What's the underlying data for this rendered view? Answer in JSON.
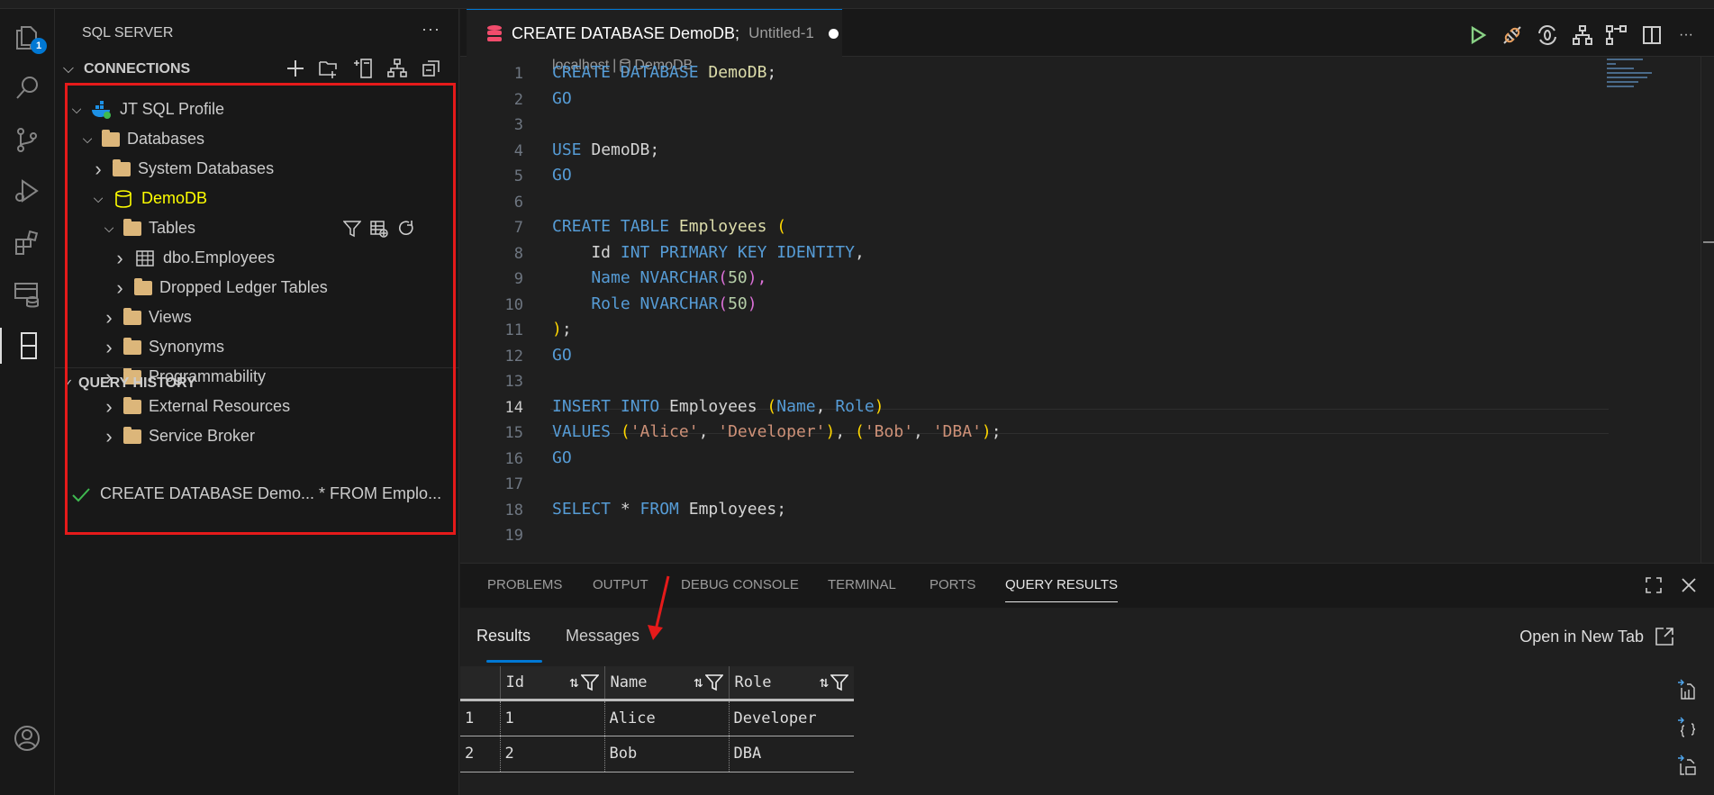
{
  "activity_bar": {
    "explorer_badge": "1"
  },
  "sidebar": {
    "title": "SQL SERVER",
    "more": "···",
    "connections_label": "CONNECTIONS",
    "tree": [
      {
        "label": "JT SQL Profile",
        "depth": 0,
        "twisty": "open",
        "icon": "docker-server-icon"
      },
      {
        "label": "Databases",
        "depth": 1,
        "twisty": "open",
        "icon": "folder-icon"
      },
      {
        "label": "System Databases",
        "depth": 2,
        "twisty": "closed",
        "icon": "folder-icon"
      },
      {
        "label": "DemoDB",
        "depth": 2,
        "twisty": "open",
        "icon": "database-icon",
        "highlight": "#ffff00"
      },
      {
        "label": "Tables",
        "depth": 3,
        "twisty": "open",
        "icon": "folder-icon"
      },
      {
        "label": "dbo.Employees",
        "depth": 4,
        "twisty": "closed",
        "icon": "table-icon"
      },
      {
        "label": "Dropped Ledger Tables",
        "depth": 4,
        "twisty": "closed",
        "icon": "folder-icon"
      },
      {
        "label": "Views",
        "depth": 3,
        "twisty": "closed",
        "icon": "folder-icon"
      },
      {
        "label": "Synonyms",
        "depth": 3,
        "twisty": "closed",
        "icon": "folder-icon"
      },
      {
        "label": "Programmability",
        "depth": 3,
        "twisty": "closed",
        "icon": "folder-icon"
      },
      {
        "label": "External Resources",
        "depth": 3,
        "twisty": "closed",
        "icon": "folder-icon"
      },
      {
        "label": "Service Broker",
        "depth": 3,
        "twisty": "closed",
        "icon": "folder-icon"
      }
    ],
    "query_history_label": "QUERY HISTORY",
    "query_history": [
      {
        "text": "CREATE DATABASE Demo... * FROM Emplo...",
        "status": "success"
      }
    ]
  },
  "editor": {
    "tab_title": "CREATE DATABASE DemoDB;",
    "tab_subtitle": "Untitled-1",
    "breadcrumb_server": "localhost",
    "breadcrumb_sep": "|",
    "breadcrumb_db": "DemoDB",
    "current_line": 14,
    "lines": [
      [
        [
          "CREATE DATABASE ",
          "kw"
        ],
        [
          "DemoDB",
          "id"
        ],
        [
          ";",
          "pl"
        ]
      ],
      [
        [
          "GO",
          "kw"
        ]
      ],
      [],
      [
        [
          "USE ",
          "kw"
        ],
        [
          "DemoDB;",
          "pl"
        ]
      ],
      [
        [
          "GO",
          "kw"
        ]
      ],
      [],
      [
        [
          "CREATE TABLE ",
          "kw"
        ],
        [
          "Employees ",
          "id"
        ],
        [
          "(",
          "br"
        ]
      ],
      [
        [
          "    Id ",
          "pl"
        ],
        [
          "INT PRIMARY KEY IDENTITY",
          "kw"
        ],
        [
          ",",
          "pl"
        ]
      ],
      [
        [
          "    Name ",
          "kw"
        ],
        [
          "NVARCHAR",
          "kw"
        ],
        [
          "(",
          "bn"
        ],
        [
          "50",
          "nm"
        ],
        [
          "),",
          "bn"
        ]
      ],
      [
        [
          "    Role ",
          "kw"
        ],
        [
          "NVARCHAR",
          "kw"
        ],
        [
          "(",
          "bn"
        ],
        [
          "50",
          "nm"
        ],
        [
          ")",
          "bn"
        ]
      ],
      [
        [
          ")",
          "br"
        ],
        [
          ";",
          "pl"
        ]
      ],
      [
        [
          "GO",
          "kw"
        ]
      ],
      [],
      [
        [
          "INSERT INTO ",
          "kw"
        ],
        [
          "Employees ",
          "pl"
        ],
        [
          "(",
          "br"
        ],
        [
          "Name",
          "kw"
        ],
        [
          ", ",
          "pl"
        ],
        [
          "Role",
          "kw"
        ],
        [
          ")",
          "br"
        ]
      ],
      [
        [
          "VALUES ",
          "kw"
        ],
        [
          "(",
          "br"
        ],
        [
          "'Alice'",
          "str"
        ],
        [
          ", ",
          "pl"
        ],
        [
          "'Developer'",
          "str"
        ],
        [
          ")",
          "br"
        ],
        [
          ", ",
          "pl"
        ],
        [
          "(",
          "br"
        ],
        [
          "'Bob'",
          "str"
        ],
        [
          ", ",
          "pl"
        ],
        [
          "'DBA'",
          "str"
        ],
        [
          ")",
          "br"
        ],
        [
          ";",
          "pl"
        ]
      ],
      [
        [
          "GO",
          "kw"
        ]
      ],
      [],
      [
        [
          "SELECT ",
          "kw"
        ],
        [
          "* ",
          "pl"
        ],
        [
          "FROM ",
          "kw"
        ],
        [
          "Employees;",
          "pl"
        ]
      ],
      []
    ]
  },
  "panel": {
    "tabs": [
      "PROBLEMS",
      "OUTPUT",
      "DEBUG CONSOLE",
      "TERMINAL",
      "PORTS",
      "QUERY RESULTS"
    ],
    "active_tab": "QUERY RESULTS",
    "result_tabs": [
      "Results",
      "Messages"
    ],
    "open_new_tab": "Open in New Tab",
    "columns": [
      "Id",
      "Name",
      "Role"
    ],
    "rows": [
      [
        "1",
        "1",
        "Alice",
        "Developer"
      ],
      [
        "2",
        "2",
        "Bob",
        "DBA"
      ]
    ]
  }
}
